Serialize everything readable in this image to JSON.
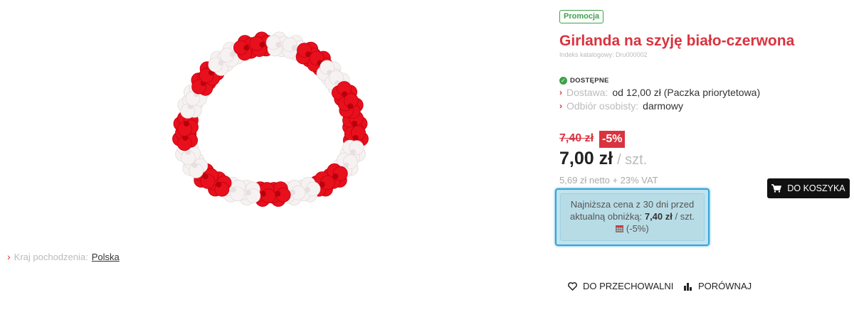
{
  "product": {
    "badge": "Promocja",
    "title": "Girlanda na szyję biało-czerwona",
    "catalog_index": "Indeks katalogowy: Dru000002",
    "image_icon": "lei-garland-image",
    "origin_label": "Kraj pochodzenia:",
    "origin_value": "Polska"
  },
  "availability": {
    "status": "DOSTĘPNE",
    "delivery_label": "Dostawa:",
    "delivery_value": "od 12,00 zł (Paczka priorytetowa)",
    "pickup_label": "Odbiór osobisty:",
    "pickup_value": "darmowy"
  },
  "pricing": {
    "old_price": "7,40 zł",
    "discount": "-5%",
    "price": "7,00 zł",
    "unit": "/ szt.",
    "net": "5,69 zł netto + 23% VAT"
  },
  "omnibus": {
    "line1": "Najniższa cena z 30 dni przed",
    "line2_prefix": "aktualną obniżką:",
    "line2_price": "7,40 zł",
    "line2_unit": "/ szt.",
    "percent": "(-5%)"
  },
  "actions": {
    "cart": "DO KOSZYKA",
    "storage": "DO PRZECHOWALNI",
    "compare": "PORÓWNAJ"
  },
  "colors": {
    "accent_red": "#d9333f",
    "promo_green": "#3ea14a",
    "omnibus_border": "#33a4dc",
    "omnibus_bg": "#c0e3ee",
    "cart_bg": "#111111"
  }
}
